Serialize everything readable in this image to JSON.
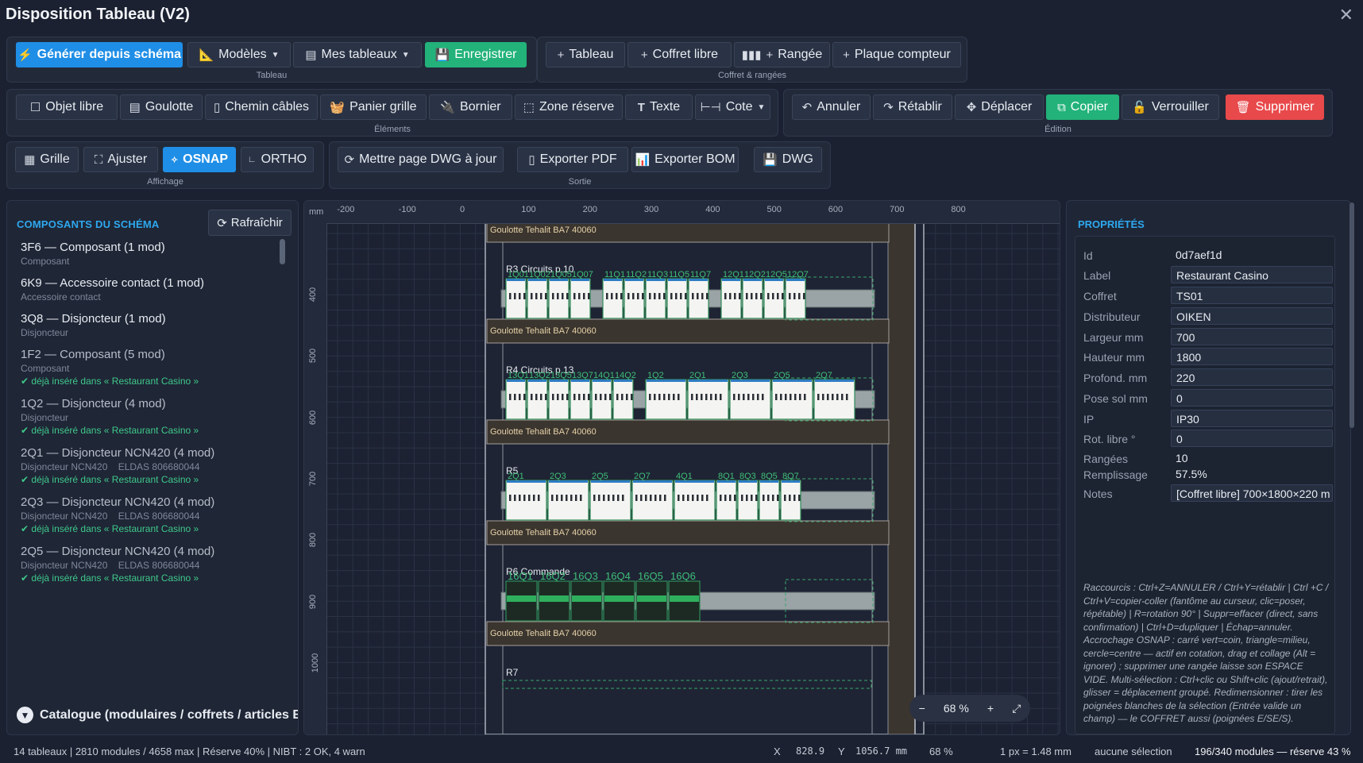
{
  "window": {
    "title": "Disposition Tableau (V2)",
    "close": "✕"
  },
  "toolbar": {
    "tableau": {
      "caption": "Tableau",
      "generate": "Générer depuis schéma",
      "models": "Modèles",
      "my_boards": "Mes tableaux",
      "save": "Enregistrer"
    },
    "coffret": {
      "caption": "Coffret & rangées",
      "board": "Tableau",
      "free_box": "Coffret libre",
      "row": "Rangée",
      "meter_plate": "Plaque compteur"
    },
    "elements": {
      "caption": "Éléments",
      "free_object": "Objet libre",
      "goulotte": "Goulotte",
      "cable_path": "Chemin câbles",
      "grid_basket": "Panier grille",
      "terminal": "Bornier",
      "reserve_zone": "Zone réserve",
      "text": "Texte",
      "dimension": "Cote"
    },
    "edition": {
      "caption": "Édition",
      "undo": "Annuler",
      "redo": "Rétablir",
      "move": "Déplacer",
      "copy": "Copier",
      "lock": "Verrouiller",
      "delete": "Supprimer"
    },
    "display": {
      "caption": "Affichage",
      "grid": "Grille",
      "fit": "Ajuster",
      "osnap": "OSNAP",
      "ortho": "ORTHO"
    },
    "output": {
      "caption": "Sortie",
      "update_dwg": "Mettre page DWG à jour",
      "export_pdf": "Exporter PDF",
      "export_bom": "Exporter BOM",
      "dwg": "DWG"
    }
  },
  "left_panel": {
    "title": "COMPOSANTS DU SCHÉMA",
    "refresh": "Rafraîchir",
    "components": [
      {
        "name": "3F6 — Composant (1 mod)",
        "sub": "Composant",
        "ok": ""
      },
      {
        "name": "6K9 — Accessoire contact (1 mod)",
        "sub": "Accessoire contact",
        "ok": ""
      },
      {
        "name": "3Q8 — Disjoncteur (1 mod)",
        "sub": "Disjoncteur",
        "ok": ""
      },
      {
        "name": "1F2 — Composant (5 mod)",
        "sub": "Composant",
        "ok": "déjà inséré dans « Restaurant Casino »"
      },
      {
        "name": "1Q2 — Disjoncteur (4 mod)",
        "sub": "Disjoncteur",
        "ok": "déjà inséré dans « Restaurant Casino »"
      },
      {
        "name": "2Q1 — Disjoncteur NCN420 (4 mod)",
        "sub": "Disjoncteur NCN420    ELDAS 806680044",
        "ok": "déjà inséré dans « Restaurant Casino »"
      },
      {
        "name": "2Q3 — Disjoncteur NCN420 (4 mod)",
        "sub": "Disjoncteur NCN420    ELDAS 806680044",
        "ok": "déjà inséré dans « Restaurant Casino »"
      },
      {
        "name": "2Q5 — Disjoncteur NCN420 (4 mod)",
        "sub": "Disjoncteur NCN420    ELDAS 806680044",
        "ok": "déjà inséré dans « Restaurant Casino »"
      }
    ],
    "catalog": "Catalogue (modulaires / coffrets / articles El"
  },
  "canvas": {
    "unit": "mm",
    "x_ticks": [
      -200,
      -100,
      0,
      100,
      200,
      300,
      400,
      500,
      600,
      700,
      800
    ],
    "y_ticks": [
      400,
      500,
      600,
      700,
      800,
      900,
      1000
    ],
    "goulotte_label": "Goulotte Tehalit BA7 40060",
    "rows": [
      {
        "label": "R3 Circuits p.10",
        "codes": [
          "1Q01",
          "1Q02",
          "1Q05",
          "1Q07",
          "11Q1",
          "11Q2",
          "11Q3",
          "11Q5",
          "11Q7",
          "12Q1",
          "12Q2",
          "12Q5",
          "12Q7"
        ]
      },
      {
        "label": "R4 Circuits p.13",
        "codes": [
          "13Q1",
          "13Q2",
          "13Q5",
          "13Q7",
          "14Q1",
          "14Q2",
          "1Q2",
          "2Q1",
          "2Q3",
          "2Q5",
          "2Q7"
        ]
      },
      {
        "label": "R5",
        "codes": [
          "2Q1",
          "2Q3",
          "2Q5",
          "2Q7",
          "4Q1",
          "8Q1",
          "8Q3",
          "8Q5",
          "8Q7"
        ]
      },
      {
        "label": "R6 Commande",
        "codes": [
          "16Q1",
          "16Q2",
          "16Q3",
          "16Q4",
          "16Q5",
          "16Q6"
        ]
      },
      {
        "label": "R7",
        "codes": []
      }
    ],
    "zoom": {
      "minus": "−",
      "value": "68 %",
      "plus": "+",
      "fit": "⤢"
    }
  },
  "properties": {
    "title": "PROPRIÉTÉS",
    "fields": [
      {
        "label": "Id",
        "value": "0d7aef1d",
        "editable": false
      },
      {
        "label": "Label",
        "value": "Restaurant Casino",
        "editable": true
      },
      {
        "label": "Coffret",
        "value": "TS01",
        "editable": true
      },
      {
        "label": "Distributeur",
        "value": "OIKEN",
        "editable": true
      },
      {
        "label": "Largeur mm",
        "value": "700",
        "editable": true
      },
      {
        "label": "Hauteur mm",
        "value": "1800",
        "editable": true
      },
      {
        "label": "Profond. mm",
        "value": "220",
        "editable": true
      },
      {
        "label": "Pose sol mm",
        "value": "0",
        "editable": true
      },
      {
        "label": "IP",
        "value": "IP30",
        "editable": true
      },
      {
        "label": "Rot. libre °",
        "value": "0",
        "editable": true
      },
      {
        "label": "Rangées",
        "value": "10",
        "editable": false
      },
      {
        "label": "Remplissage",
        "value": "57.5%",
        "editable": false
      },
      {
        "label": "Notes",
        "value": "[Coffret libre] 700×1800×220 m",
        "editable": true
      }
    ],
    "shortcuts": "Raccourcis : Ctrl+Z=ANNULER / Ctrl+Y=rétablir  |  Ctrl +C / Ctrl+V=copier-coller (fantôme au curseur, clic=poser, répétable)  |  R=rotation 90°  |  Suppr=effacer (direct, sans confirmation)  |  Ctrl+D=dupliquer  |  Échap=annuler. Accrochage OSNAP : carré vert=coin, triangle=milieu, cercle=centre — actif en cotation, drag et collage (Alt = ignorer) ; supprimer une rangée laisse son ESPACE VIDE. Multi-sélection : Ctrl+clic ou Shift+clic (ajout/retrait), glisser = déplacement groupé. Redimensionner : tirer les poignées blanches de la sélection (Entrée valide un champ) — le COFFRET aussi (poignées E/SE/S)."
  },
  "status": {
    "summary": "14 tableaux | 2810 modules / 4658 max | Réserve 40% | NIBT : 2 OK, 4 warn",
    "x_label": "X",
    "x_value": "828.9",
    "y_label": "Y",
    "y_value": "1056.7 mm",
    "zoom": "68 %",
    "scale": "1 px = 1.48 mm",
    "selection": "aucune sélection",
    "modules": "196/340 modules — réserve 43 %"
  }
}
